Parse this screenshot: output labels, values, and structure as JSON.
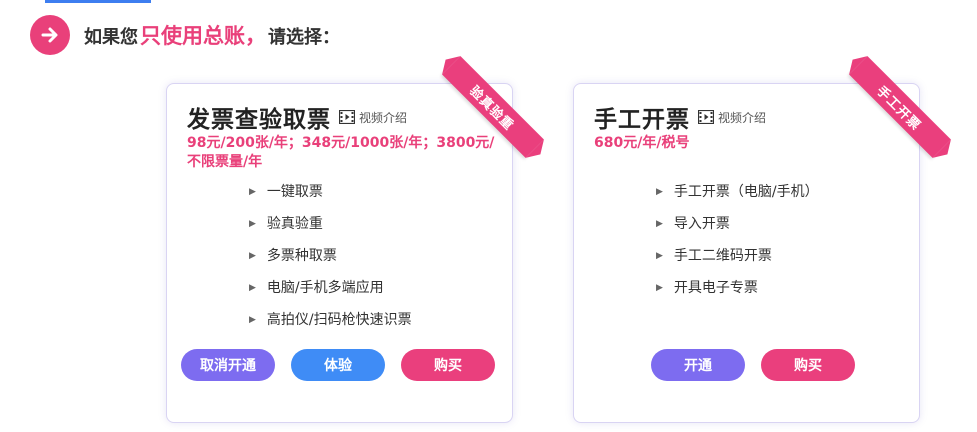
{
  "header": {
    "prefix": "如果您",
    "highlight": "只使用总账，",
    "suffix": "请选择："
  },
  "cards": [
    {
      "title": "发票查验取票",
      "video_label": "视频介绍",
      "ribbon": "验真验重",
      "price": "98元/200张/年；348元/1000张/年；3800元/不限票量/年",
      "features": [
        "一键取票",
        "验真验重",
        "多票种取票",
        "电脑/手机多端应用",
        "高拍仪/扫码枪快速识票"
      ],
      "buttons": [
        "取消开通",
        "体验",
        "购买"
      ]
    },
    {
      "title": "手工开票",
      "video_label": "视频介绍",
      "ribbon": "手工开票",
      "price": "680元/年/税号",
      "features": [
        "手工开票（电脑/手机）",
        "导入开票",
        "手工二维码开票",
        "开具电子专票"
      ],
      "buttons": [
        "开通",
        "购买"
      ]
    }
  ],
  "colors": {
    "accent_pink": "#ea3f7d",
    "purple": "#7d6cf0",
    "blue": "#3f8cf6"
  },
  "icons": {
    "arrow": "arrow-right-icon",
    "video": "film-icon",
    "bullet": "triangle-right-icon"
  }
}
